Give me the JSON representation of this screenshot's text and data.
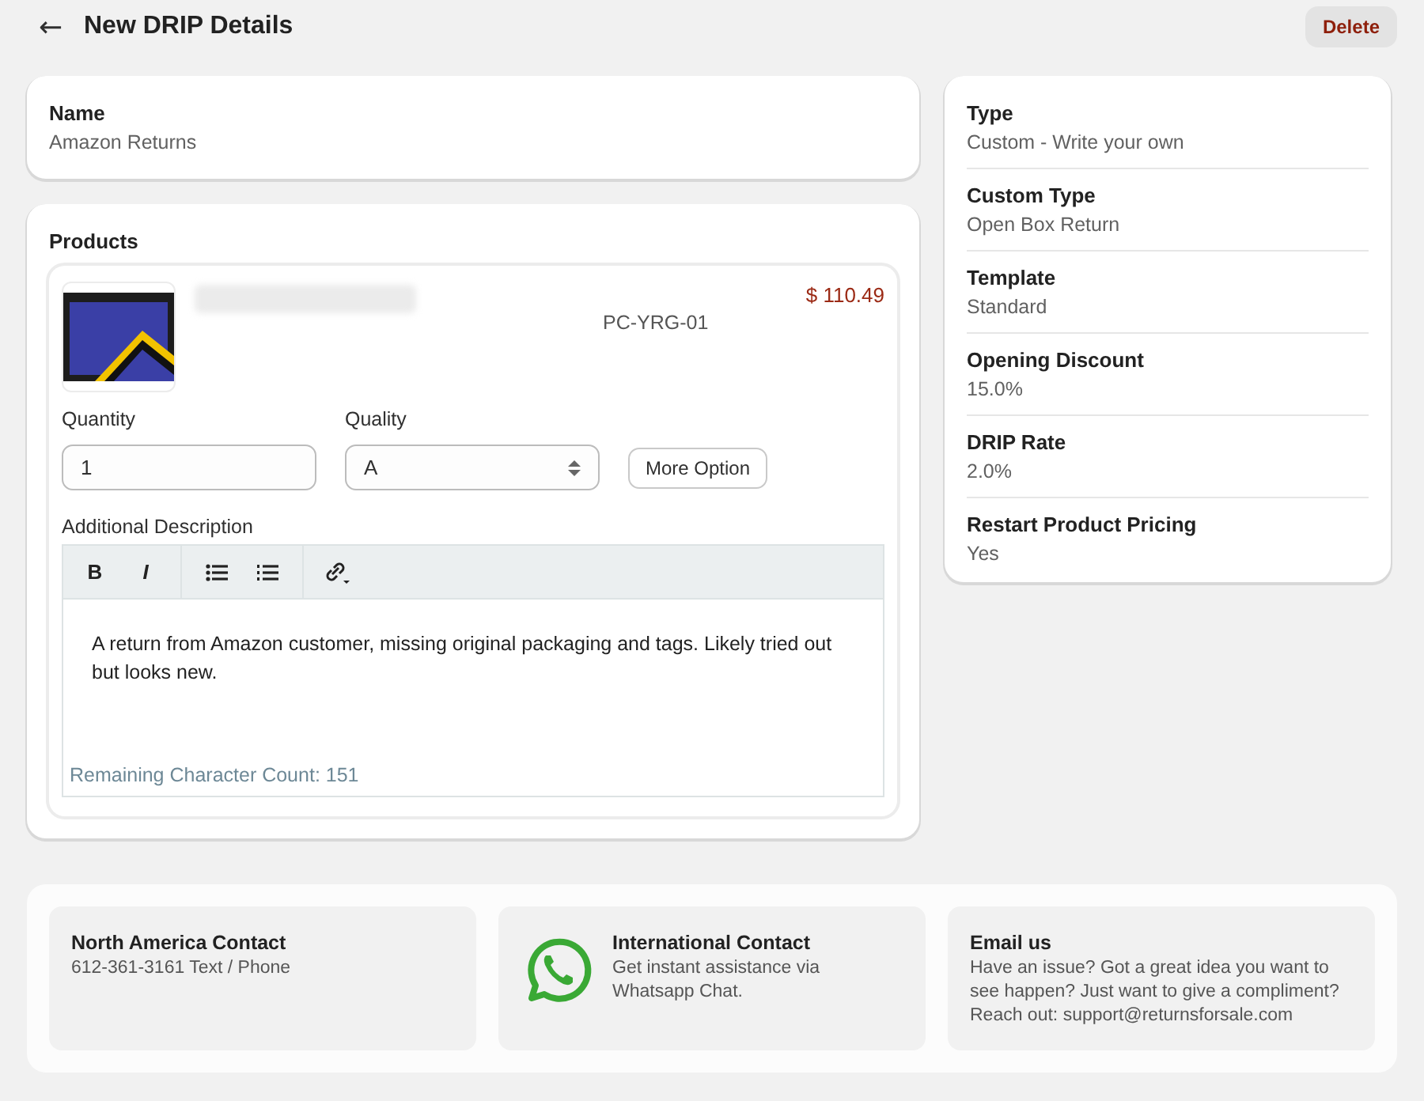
{
  "header": {
    "back": "←",
    "title": "New DRIP Details",
    "delete": "Delete"
  },
  "name_card": {
    "label": "Name",
    "value": "Amazon Returns"
  },
  "products": {
    "title": "Products",
    "items": [
      {
        "price": "$ 110.49",
        "sku": "PC-YRG-01",
        "quantity_label": "Quantity",
        "quantity": "1",
        "quality_label": "Quality",
        "quality": "A",
        "more_option": "More Option",
        "description_label": "Additional Description",
        "toolbar": [
          {
            "kind": "bold",
            "label": "B"
          },
          {
            "kind": "italic",
            "label": "I"
          },
          {
            "kind": "bullets"
          },
          {
            "kind": "numbers"
          },
          {
            "kind": "link"
          }
        ],
        "description": "A return from Amazon customer, missing original packaging and tags. Likely tried out but looks new.",
        "remaining": "Remaining Character Count: 151"
      }
    ]
  },
  "details": [
    {
      "label": "Type",
      "value": "Custom - Write your own"
    },
    {
      "label": "Custom Type",
      "value": "Open Box Return"
    },
    {
      "label": "Template",
      "value": "Standard"
    },
    {
      "label": "Opening Discount",
      "value": "15.0%"
    },
    {
      "label": "DRIP Rate",
      "value": "2.0%"
    },
    {
      "label": "Restart Product Pricing",
      "value": "Yes"
    }
  ],
  "contacts": [
    {
      "kind": "plain",
      "title": "North America Contact",
      "lines": [
        "612-361-3161 Text / Phone"
      ]
    },
    {
      "kind": "whatsapp",
      "title": "International Contact",
      "lines": [
        "Get instant assistance via Whatsapp Chat."
      ]
    },
    {
      "kind": "plain",
      "title": "Email us",
      "lines": [
        "Have an issue? Got a great idea you want to see happen? Just want to give a compliment? Reach out: support@returnsforsale.com"
      ]
    }
  ]
}
